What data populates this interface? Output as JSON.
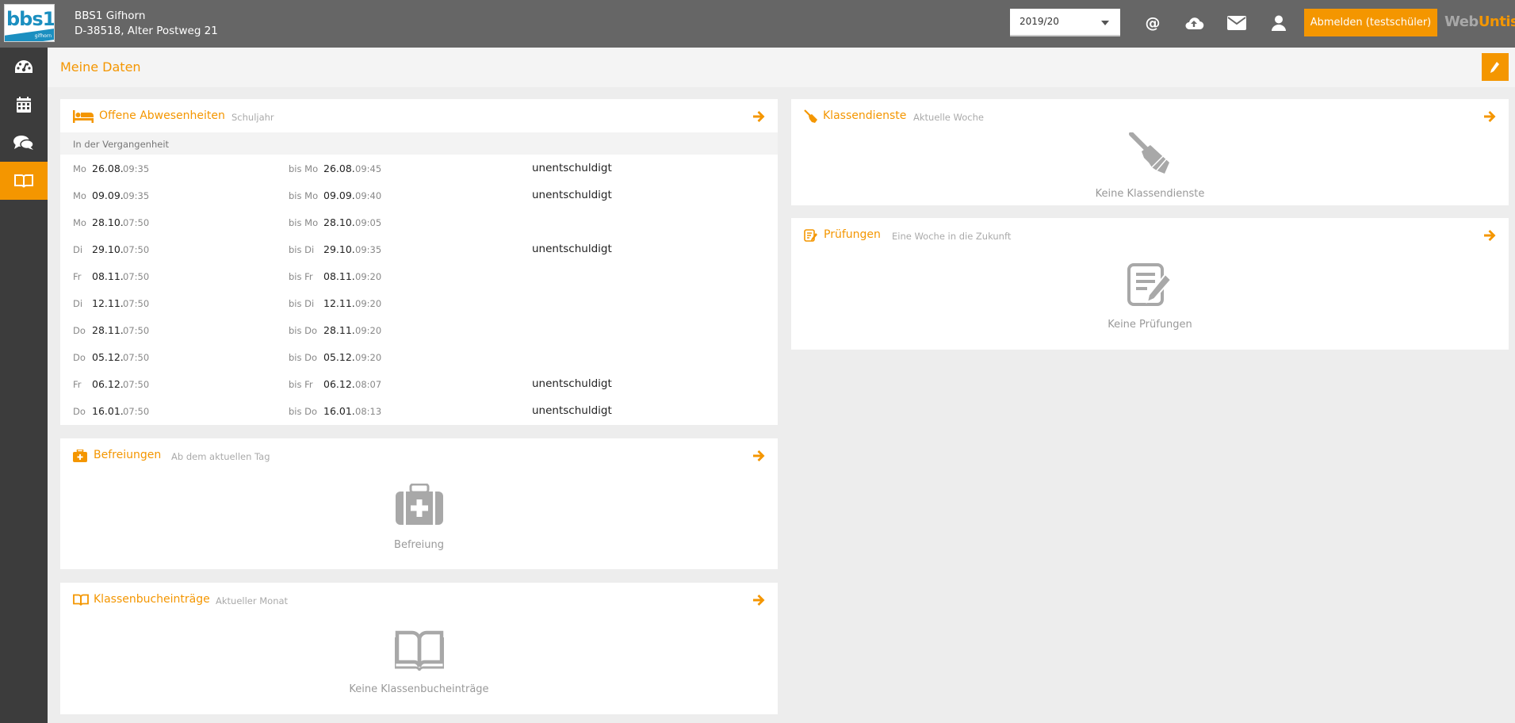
{
  "header": {
    "logo_text": "bbs1",
    "logo_sub": "gifhorn",
    "school_name": "BBS1 Gifhorn",
    "school_address": "D-38518, Alter Postweg 21",
    "year_selected": "2019/20",
    "logout_label": "Abmelden (testschüler)",
    "brand_web": "Web",
    "brand_untis": "Untis",
    "at_symbol": "@",
    "icons": [
      "at-icon",
      "cloud-upload-icon",
      "mail-icon",
      "user-icon"
    ]
  },
  "sidebar": {
    "items": [
      {
        "icon": "dashboard-icon",
        "active": false
      },
      {
        "icon": "calendar-icon",
        "active": false
      },
      {
        "icon": "chat-icon",
        "active": false
      },
      {
        "icon": "book-icon",
        "active": true
      }
    ]
  },
  "page": {
    "title": "Meine Daten"
  },
  "colors": {
    "accent": "#f49600",
    "topbar": "#666666",
    "sidebar": "#3c3c3c"
  },
  "absences": {
    "title": "Offene Abwesenheiten",
    "subtitle": "Schuljahr",
    "section": "In der Vergangenheit",
    "rows": [
      {
        "day": "Mo",
        "date": "26.08.",
        "time": "09:35",
        "bis": "bis Mo",
        "date2": "26.08.",
        "time2": "09:45",
        "status": "unentschuldigt"
      },
      {
        "day": "Mo",
        "date": "09.09.",
        "time": "09:35",
        "bis": "bis Mo",
        "date2": "09.09.",
        "time2": "09:40",
        "status": "unentschuldigt"
      },
      {
        "day": "Mo",
        "date": "28.10.",
        "time": "07:50",
        "bis": "bis Mo",
        "date2": "28.10.",
        "time2": "09:05",
        "status": ""
      },
      {
        "day": "Di",
        "date": "29.10.",
        "time": "07:50",
        "bis": "bis Di",
        "date2": "29.10.",
        "time2": "09:35",
        "status": "unentschuldigt"
      },
      {
        "day": "Fr",
        "date": "08.11.",
        "time": "07:50",
        "bis": "bis Fr",
        "date2": "08.11.",
        "time2": "09:20",
        "status": ""
      },
      {
        "day": "Di",
        "date": "12.11.",
        "time": "07:50",
        "bis": "bis Di",
        "date2": "12.11.",
        "time2": "09:20",
        "status": ""
      },
      {
        "day": "Do",
        "date": "28.11.",
        "time": "07:50",
        "bis": "bis Do",
        "date2": "28.11.",
        "time2": "09:20",
        "status": ""
      },
      {
        "day": "Do",
        "date": "05.12.",
        "time": "07:50",
        "bis": "bis Do",
        "date2": "05.12.",
        "time2": "09:20",
        "status": ""
      },
      {
        "day": "Fr",
        "date": "06.12.",
        "time": "07:50",
        "bis": "bis Fr",
        "date2": "06.12.",
        "time2": "08:07",
        "status": "unentschuldigt"
      },
      {
        "day": "Do",
        "date": "16.01.",
        "time": "07:50",
        "bis": "bis Do",
        "date2": "16.01.",
        "time2": "08:13",
        "status": "unentschuldigt"
      }
    ]
  },
  "exemptions": {
    "title": "Befreiungen",
    "subtitle": "Ab dem aktuellen Tag",
    "empty": "Befreiung"
  },
  "classbook": {
    "title": "Klassenbucheinträge",
    "subtitle": "Aktueller Monat",
    "empty": "Keine Klassenbucheinträge"
  },
  "classduties": {
    "title": "Klassendienste",
    "subtitle": "Aktuelle Woche",
    "empty": "Keine Klassendienste"
  },
  "exams": {
    "title": "Prüfungen",
    "subtitle": "Eine Woche in die Zukunft",
    "empty": "Keine Prüfungen"
  }
}
